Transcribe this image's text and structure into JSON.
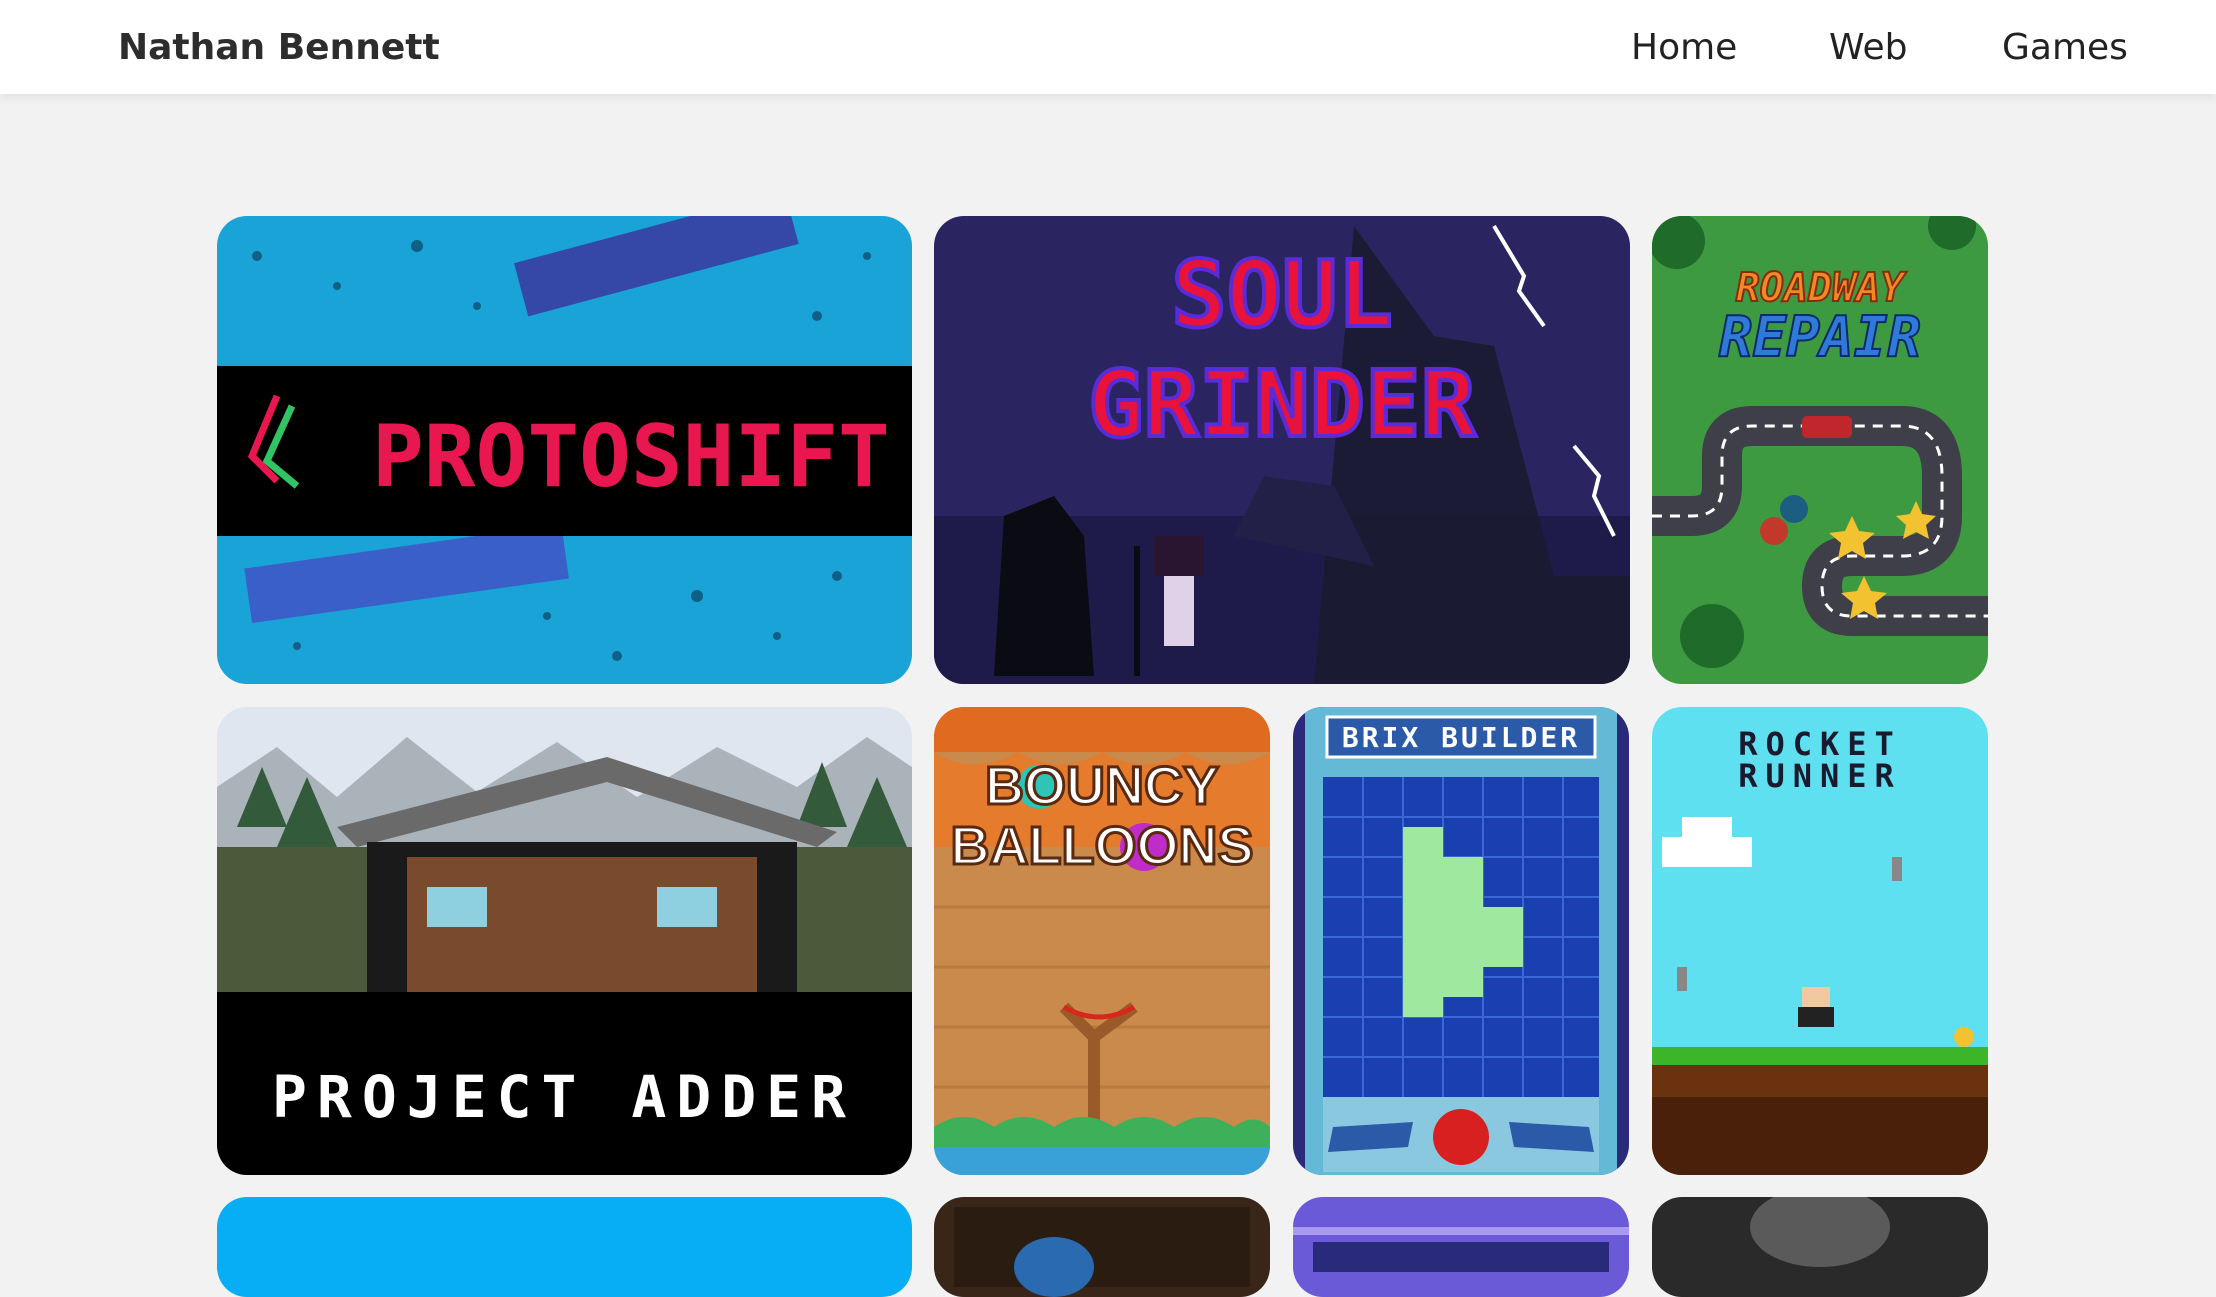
{
  "header": {
    "brand": "Nathan Bennett",
    "nav": [
      "Home",
      "Web",
      "Games"
    ]
  },
  "games": [
    {
      "title": "PROTOSHIFT",
      "colors": [
        "#e8174f",
        "#f5a623",
        "#a8c526",
        "#31c464"
      ]
    },
    {
      "title_line1": "SOUL",
      "title_line2": "GRINDER"
    },
    {
      "title_line1": "ROADWAY",
      "title_line2": "REPAIR"
    },
    {
      "title": "PROJECT ADDER"
    },
    {
      "title_line1": "BOUNCY",
      "title_line2": "BALLOONS"
    },
    {
      "title": "BRIX BUILDER"
    },
    {
      "title_line1": "ROCKET",
      "title_line2": "RUNNER"
    }
  ]
}
